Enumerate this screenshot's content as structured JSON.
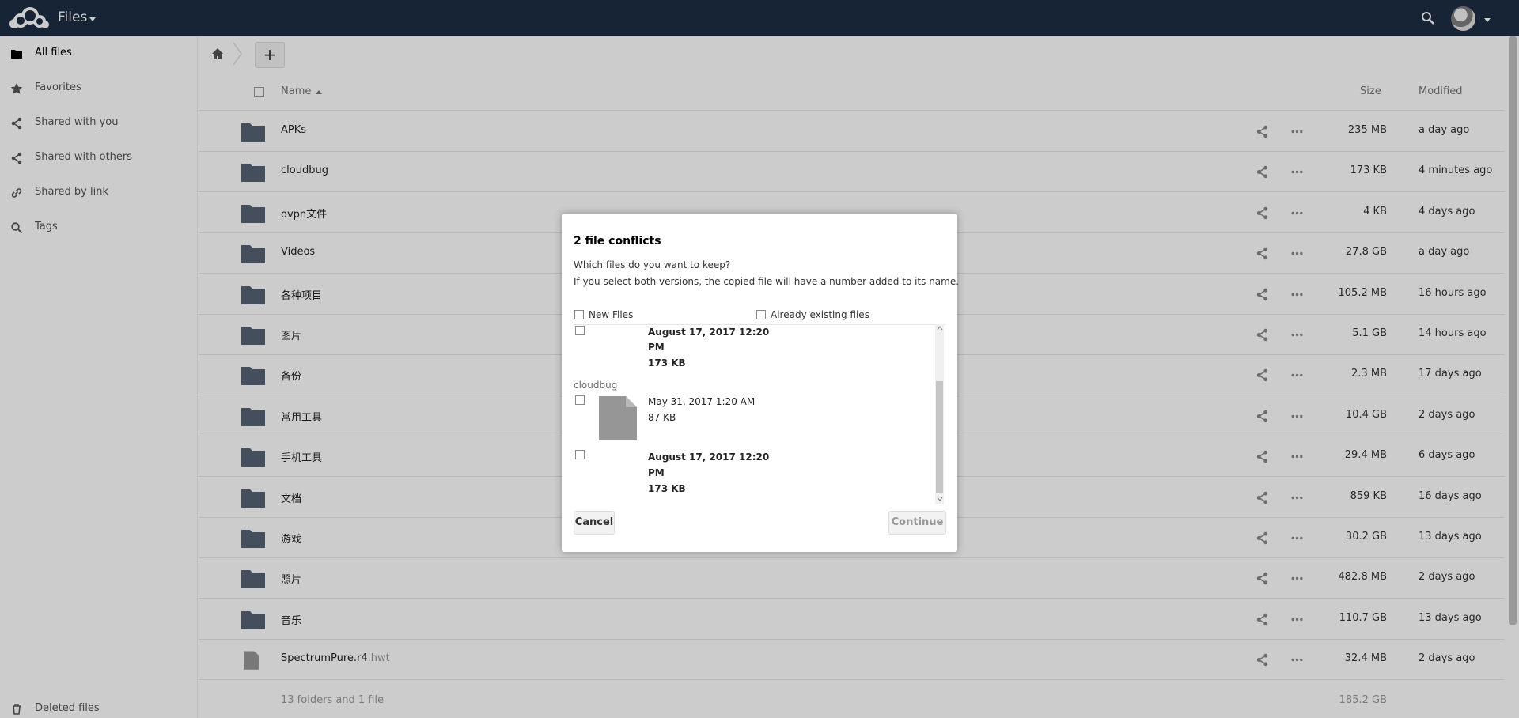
{
  "header": {
    "app_name": "Files",
    "logo_icon": "owncloud-logo",
    "search_icon": "search-icon",
    "avatar_icon": "user-avatar",
    "background_color": "#1d2d44"
  },
  "sidebar": {
    "items": [
      {
        "label": "All files",
        "icon": "folder-icon",
        "active": true
      },
      {
        "label": "Favorites",
        "icon": "star-icon"
      },
      {
        "label": "Shared with you",
        "icon": "share-icon"
      },
      {
        "label": "Shared with others",
        "icon": "share-icon"
      },
      {
        "label": "Shared by link",
        "icon": "link-icon"
      },
      {
        "label": "Tags",
        "icon": "search-icon"
      }
    ],
    "footer": {
      "label": "Deleted files",
      "icon": "trash-icon"
    }
  },
  "controls": {
    "home_icon": "home-icon",
    "new_label": "+"
  },
  "table": {
    "columns": {
      "name": "Name",
      "size": "Size",
      "modified": "Modified"
    },
    "rows": [
      {
        "name": "APKs",
        "ext": "",
        "type": "folder",
        "size": "235 MB",
        "modified": "a day ago"
      },
      {
        "name": "cloudbug",
        "ext": "",
        "type": "folder",
        "size": "173 KB",
        "modified": "4 minutes ago"
      },
      {
        "name": "ovpn文件",
        "ext": "",
        "type": "folder",
        "size": "4 KB",
        "modified": "4 days ago"
      },
      {
        "name": "Videos",
        "ext": "",
        "type": "folder",
        "size": "27.8 GB",
        "modified": "a day ago"
      },
      {
        "name": "各种项目",
        "ext": "",
        "type": "folder",
        "size": "105.2 MB",
        "modified": "16 hours ago"
      },
      {
        "name": "图片",
        "ext": "",
        "type": "folder",
        "size": "5.1 GB",
        "modified": "14 hours ago"
      },
      {
        "name": "备份",
        "ext": "",
        "type": "folder",
        "size": "2.3 MB",
        "modified": "17 days ago"
      },
      {
        "name": "常用工具",
        "ext": "",
        "type": "folder",
        "size": "10.4 GB",
        "modified": "2 days ago"
      },
      {
        "name": "手机工具",
        "ext": "",
        "type": "folder",
        "size": "29.4 MB",
        "modified": "6 days ago"
      },
      {
        "name": "文档",
        "ext": "",
        "type": "folder",
        "size": "859 KB",
        "modified": "16 days ago"
      },
      {
        "name": "游戏",
        "ext": "",
        "type": "folder",
        "size": "30.2 GB",
        "modified": "13 days ago"
      },
      {
        "name": "照片",
        "ext": "",
        "type": "folder",
        "size": "482.8 MB",
        "modified": "2 days ago"
      },
      {
        "name": "音乐",
        "ext": "",
        "type": "folder",
        "size": "110.7 GB",
        "modified": "13 days ago"
      },
      {
        "name": "SpectrumPure.r4",
        "ext": ".hwt",
        "type": "file",
        "size": "32.4 MB",
        "modified": "2 days ago"
      }
    ],
    "summary": {
      "text": "13 folders and 1 file",
      "size": "185.2 GB"
    }
  },
  "dialog": {
    "title": "2 file conflicts",
    "question": "Which files do you want to keep?",
    "explanation": "If you select both versions, the copied file will have a number added to its name.",
    "new_files_label": "New Files",
    "existing_files_label": "Already existing files",
    "conflicts": {
      "first_existing": {
        "date_line1": "August 17, 2017 12:20",
        "date_line2": "PM",
        "size": "173 KB"
      },
      "second_filename": "cloudbug",
      "second_new": {
        "date": "May 31, 2017 1:20 AM",
        "size": "87 KB"
      },
      "second_existing": {
        "date_line1": "August 17, 2017 12:20",
        "date_line2": "PM",
        "size": "173 KB"
      }
    },
    "cancel_label": "Cancel",
    "continue_label": "Continue"
  }
}
